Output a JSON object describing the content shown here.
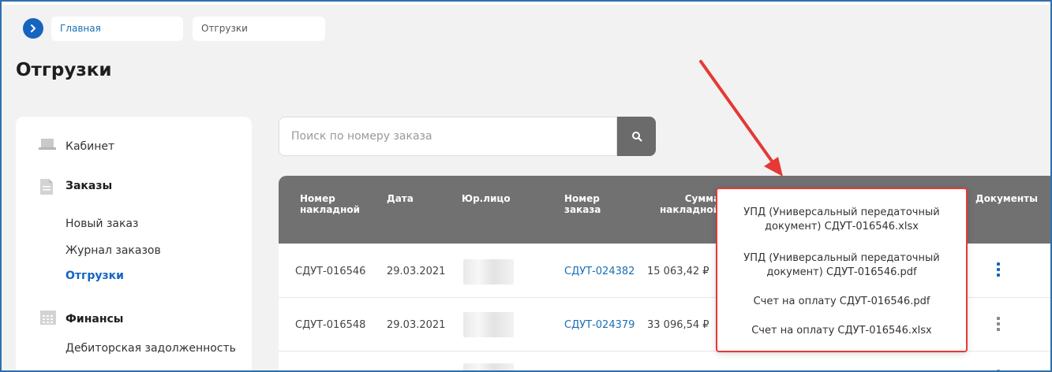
{
  "breadcrumb": {
    "home": "Главная",
    "current": "Отгрузки"
  },
  "page_title": "Отгрузки",
  "sidebar": {
    "cabinet": "Кабинет",
    "orders_heading": "Заказы",
    "orders_items": [
      "Новый заказ",
      "Журнал заказов",
      "Отгрузки"
    ],
    "finance_heading": "Финансы",
    "finance_items": [
      "Дебиторская задолженность"
    ]
  },
  "search": {
    "placeholder": "Поиск по номеру заказа"
  },
  "table": {
    "headers": {
      "invoice_no_1": "Номер",
      "invoice_no_2": "накладной",
      "date": "Дата",
      "legal_entity": "Юр.лицо",
      "order_no_1": "Номер",
      "order_no_2": "заказа",
      "sum_1": "Сумма",
      "sum_2": "накладной",
      "documents": "Документы"
    },
    "rows": [
      {
        "invoice": "СДУТ-016546",
        "date": "29.03.2021",
        "order": "СДУТ-024382",
        "sum": "15 063,42 ₽"
      },
      {
        "invoice": "СДУТ-016548",
        "date": "29.03.2021",
        "order": "СДУТ-024379",
        "sum": "33 096,54 ₽"
      }
    ]
  },
  "documents_menu": [
    "УПД (Универсальный передаточный документ) СДУТ-016546.xlsx",
    "УПД (Универсальный передаточный документ) СДУТ-016546.pdf",
    "Счет на оплату СДУТ-016546.pdf",
    "Счет на оплату СДУТ-016546.xlsx"
  ],
  "colors": {
    "accent": "#1565c0",
    "header": "#717171",
    "highlight": "#e53935"
  }
}
